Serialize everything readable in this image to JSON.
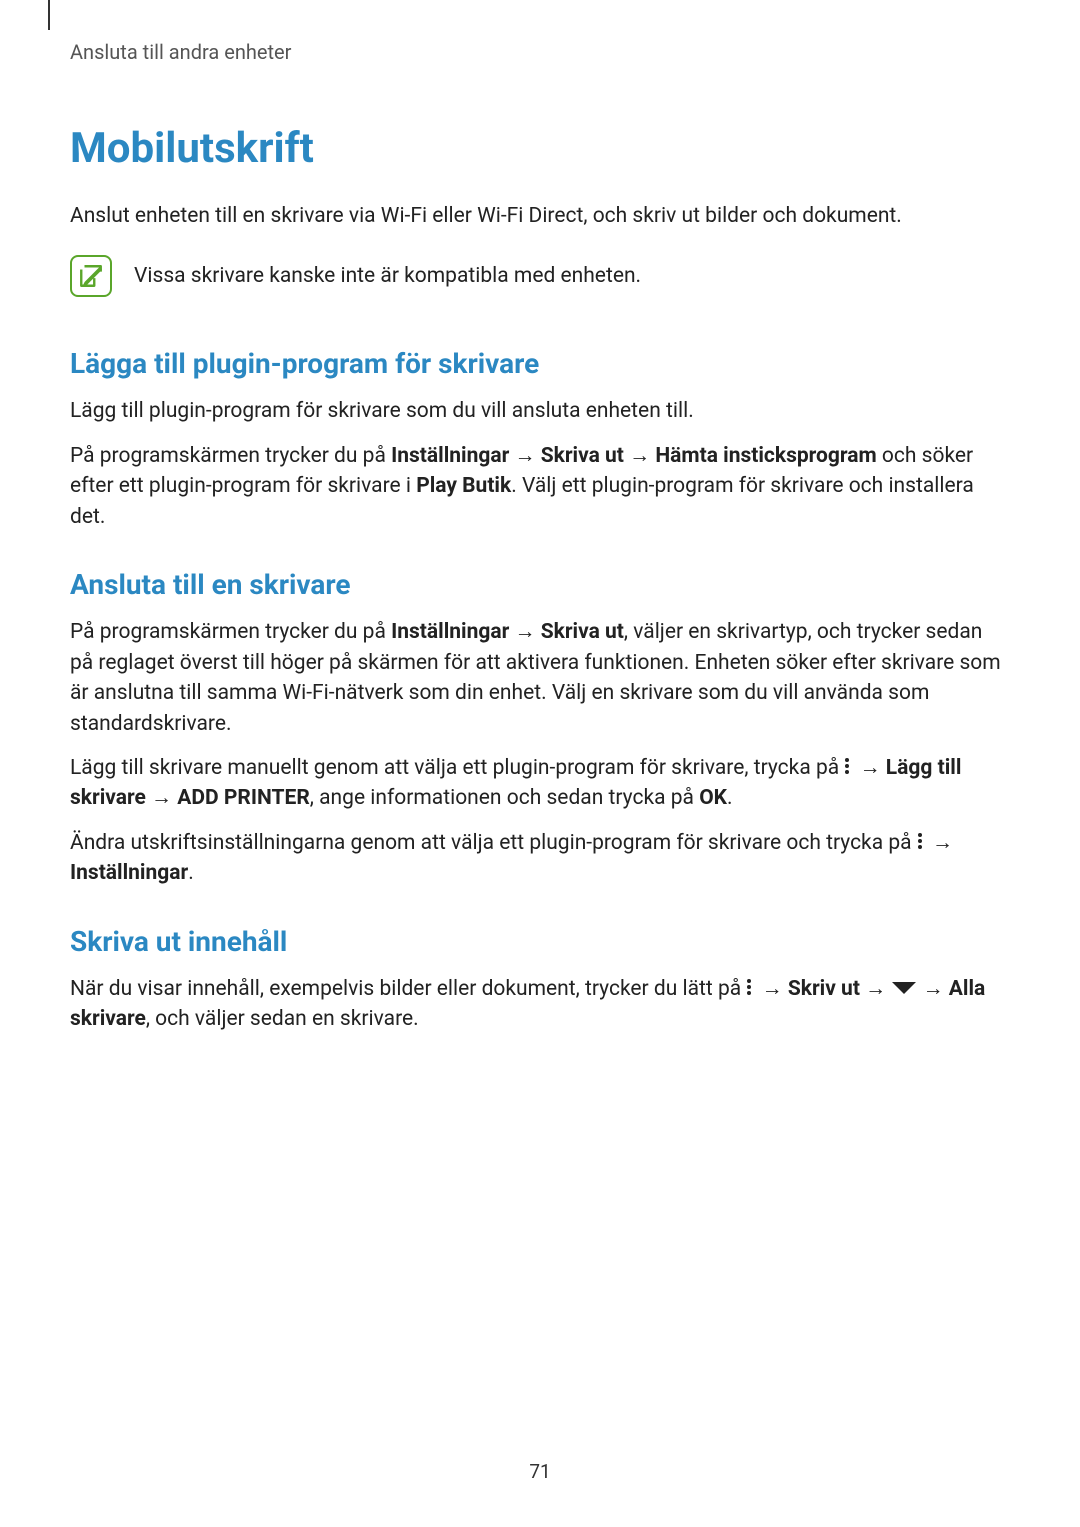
{
  "header": {
    "breadcrumb": "Ansluta till andra enheter"
  },
  "title": "Mobilutskrift",
  "intro": "Anslut enheten till en skrivare via Wi-Fi eller Wi-Fi Direct, och skriv ut bilder och dokument.",
  "note": "Vissa skrivare kanske inte är kompatibla med enheten.",
  "section1": {
    "heading": "Lägga till plugin-program för skrivare",
    "p1": "Lägg till plugin-program för skrivare som du vill ansluta enheten till.",
    "p2_a": "På programskärmen trycker du på ",
    "p2_b_bold": "Inställningar",
    "p2_c": " → ",
    "p2_d_bold": "Skriva ut",
    "p2_e": " → ",
    "p2_f_bold": "Hämta insticksprogram",
    "p2_g": " och söker efter ett plugin-program för skrivare i ",
    "p2_h_bold": "Play Butik",
    "p2_i": ". Välj ett plugin-program för skrivare och installera det."
  },
  "section2": {
    "heading": "Ansluta till en skrivare",
    "p1_a": "På programskärmen trycker du på ",
    "p1_b_bold": "Inställningar",
    "p1_c": " → ",
    "p1_d_bold": "Skriva ut",
    "p1_e": ", väljer en skrivartyp, och trycker sedan på reglaget överst till höger på skärmen för att aktivera funktionen. Enheten söker efter skrivare som är anslutna till samma Wi-Fi-nätverk som din enhet. Välj en skrivare som du vill använda som standardskrivare.",
    "p2_a": "Lägg till skrivare manuellt genom att välja ett plugin-program för skrivare, trycka på ",
    "p2_b": " → ",
    "p2_c_bold": "Lägg till skrivare",
    "p2_d": " → ",
    "p2_e_bold": "ADD PRINTER",
    "p2_f": ", ange informationen och sedan trycka på ",
    "p2_g_bold": "OK",
    "p2_h": ".",
    "p3_a": "Ändra utskriftsinställningarna genom att välja ett plugin-program för skrivare och trycka på ",
    "p3_b": " → ",
    "p3_c_bold": "Inställningar",
    "p3_d": "."
  },
  "section3": {
    "heading": "Skriva ut innehåll",
    "p1_a": "När du visar innehåll, exempelvis bilder eller dokument, trycker du lätt på ",
    "p1_b": " → ",
    "p1_c_bold": "Skriv ut",
    "p1_d": " → ",
    "p1_e": " → ",
    "p1_f_bold": "Alla skrivare",
    "p1_g": ", och väljer sedan en skrivare."
  },
  "pageNumber": "71"
}
